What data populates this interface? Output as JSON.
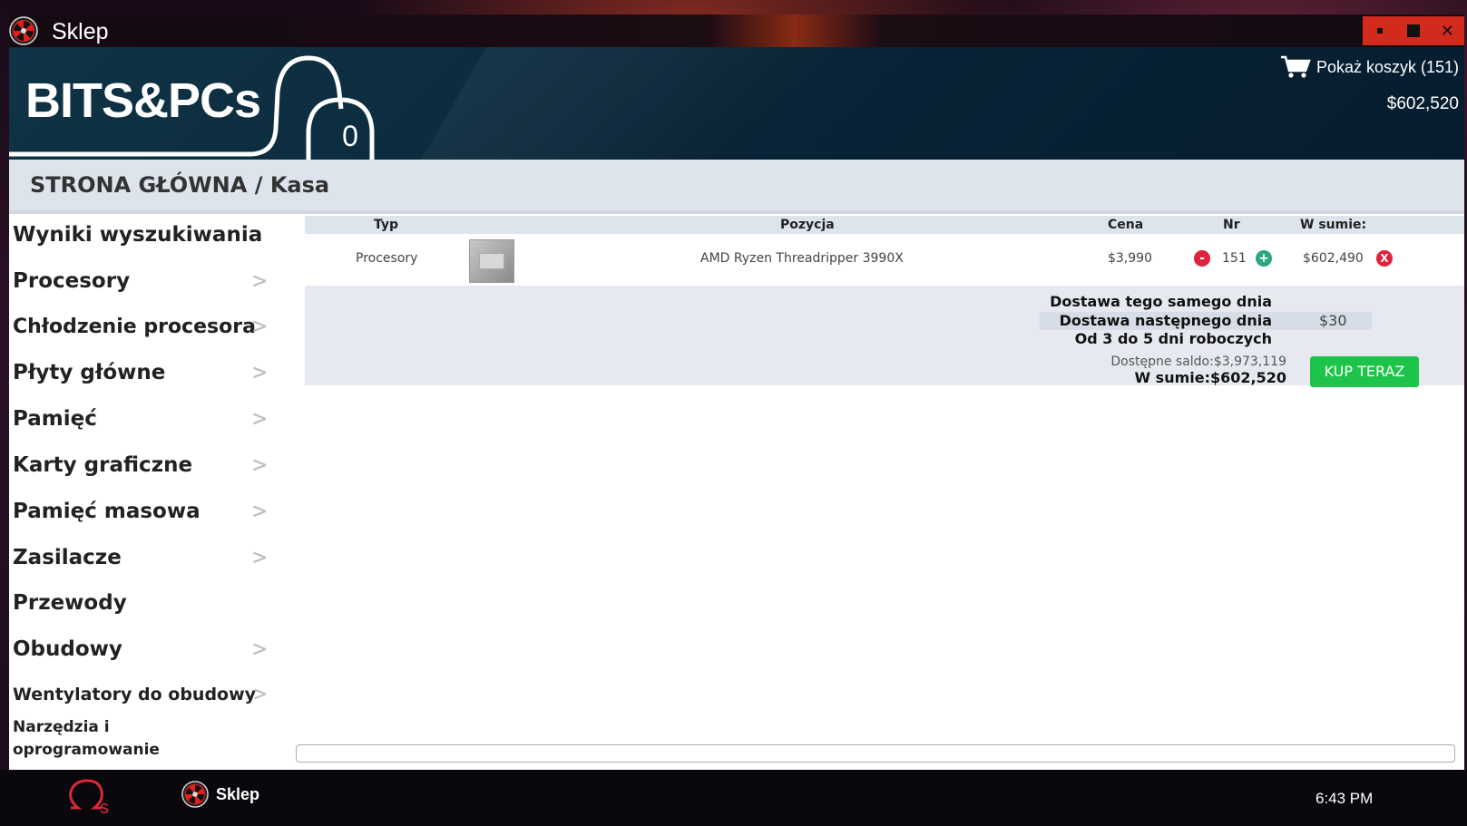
{
  "window": {
    "title": "Sklep"
  },
  "header": {
    "logo_text": "BITS&PCs",
    "cart_badge": "0",
    "cart_link": "Pokaż koszyk (151)",
    "balance": "$602,520"
  },
  "breadcrumb": "STRONA GŁÓWNA / Kasa",
  "sidebar": {
    "items": [
      {
        "label": "Wyniki wyszukiwania",
        "chevron": ""
      },
      {
        "label": "Procesory",
        "chevron": ">"
      },
      {
        "label": "Chłodzenie procesora",
        "chevron": ">"
      },
      {
        "label": "Płyty główne",
        "chevron": ">"
      },
      {
        "label": "Pamięć",
        "chevron": ">"
      },
      {
        "label": "Karty graficzne",
        "chevron": ">"
      },
      {
        "label": "Pamięć masowa",
        "chevron": ">"
      },
      {
        "label": "Zasilacze",
        "chevron": ">"
      },
      {
        "label": "Przewody",
        "chevron": ""
      },
      {
        "label": "Obudowy",
        "chevron": ">"
      },
      {
        "label": "Wentylatory do obudowy",
        "chevron": ">"
      },
      {
        "label": "Narzędzia i oprogramowanie",
        "chevron": ""
      }
    ]
  },
  "table": {
    "headers": {
      "type": "Typ",
      "item": "Pozycja",
      "price": "Cena",
      "qty": "Nr",
      "total": "W sumie:"
    },
    "rows": [
      {
        "type": "Procesory",
        "item": "AMD Ryzen Threadripper 3990X",
        "price": "$3,990",
        "qty": "151",
        "total": "$602,490",
        "minus": "-",
        "plus": "+",
        "remove": "X"
      }
    ]
  },
  "shipping": {
    "same_day": "Dostawa tego samego dnia",
    "next_day": "Dostawa następnego dnia",
    "next_day_price": "$30",
    "standard": "Od 3 do 5 dni roboczych"
  },
  "checkout": {
    "available_balance": "Dostępne saldo:$3,973,119",
    "total": "W sumie:$602,520",
    "buy_button": "KUP TERAZ"
  },
  "taskbar": {
    "app_label": "Sklep",
    "clock": "6:43 PM"
  },
  "colors": {
    "accent_red": "#d32a1e",
    "buy_green": "#1ec44a",
    "header_navy": "#0c2a3d",
    "plus_teal": "#2aa87a",
    "minus_red": "#e0223a"
  }
}
